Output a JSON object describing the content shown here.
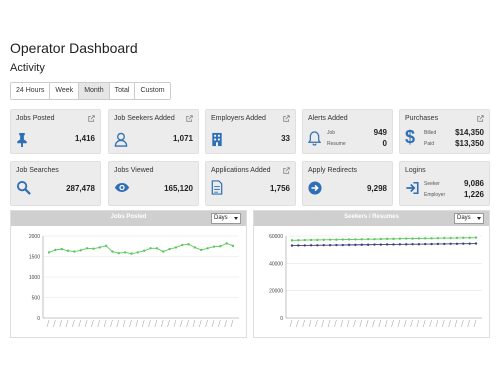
{
  "page": {
    "title": "Operator Dashboard",
    "subtitle": "Activity"
  },
  "tabs": [
    {
      "label": "24 Hours",
      "active": false
    },
    {
      "label": "Week",
      "active": false
    },
    {
      "label": "Month",
      "active": true
    },
    {
      "label": "Total",
      "active": false
    },
    {
      "label": "Custom",
      "active": false
    }
  ],
  "cards": {
    "jobs_posted": {
      "title": "Jobs Posted",
      "value": "1,416",
      "icon": "pushpin-icon"
    },
    "job_seekers_added": {
      "title": "Job Seekers Added",
      "value": "1,071",
      "icon": "user-icon"
    },
    "employers_added": {
      "title": "Employers Added",
      "value": "33",
      "icon": "building-icon"
    },
    "alerts_added": {
      "title": "Alerts Added",
      "icon": "bell-icon",
      "job_label": "Job",
      "job_value": "949",
      "resume_label": "Resume",
      "resume_value": "0"
    },
    "purchases": {
      "title": "Purchases",
      "icon": "dollar-icon",
      "billed_label": "Billed",
      "billed_value": "$14,350",
      "paid_label": "Paid",
      "paid_value": "$13,350"
    },
    "job_searches": {
      "title": "Job Searches",
      "value": "287,478",
      "icon": "search-icon"
    },
    "jobs_viewed": {
      "title": "Jobs Viewed",
      "value": "165,120",
      "icon": "eye-icon"
    },
    "applications_added": {
      "title": "Applications Added",
      "value": "1,756",
      "icon": "document-icon"
    },
    "apply_redirects": {
      "title": "Apply Redirects",
      "value": "9,298",
      "icon": "arrow-circle-icon"
    },
    "logins": {
      "title": "Logins",
      "icon": "sign-in-icon",
      "seeker_label": "Seeker",
      "seeker_value": "9,086",
      "employer_label": "Employer",
      "employer_value": "1,226"
    }
  },
  "panels": {
    "jobs_posted": {
      "title": "Jobs Posted",
      "select": "Days"
    },
    "seekers_resumes": {
      "title": "Seekers / Resumes",
      "select": "Days"
    }
  },
  "colors": {
    "green": "#5cc85c",
    "navy": "#3c3f78",
    "card_bg": "#ececec",
    "header_bg": "#cfcfcf"
  },
  "chart_data": [
    {
      "type": "line",
      "title": "Jobs Posted",
      "ylim": [
        0,
        2000
      ],
      "yticks": [
        0,
        500,
        1000,
        1500,
        2000
      ],
      "series": [
        {
          "values": [
            1600,
            1660,
            1680,
            1640,
            1620,
            1650,
            1700,
            1690,
            1720,
            1760,
            1620,
            1580,
            1600,
            1570,
            1600,
            1640,
            1700,
            1700,
            1620,
            1680,
            1720,
            1780,
            1800,
            1720,
            1660,
            1700,
            1740,
            1750,
            1820,
            1760
          ]
        }
      ]
    },
    {
      "type": "line",
      "title": "Seekers / Resumes",
      "ylim": [
        0,
        60000
      ],
      "yticks": [
        0,
        20000,
        40000,
        60000
      ],
      "series": [
        {
          "values": [
            56800,
            56900,
            57000,
            57100,
            57100,
            57200,
            57300,
            57300,
            57400,
            57500,
            57500,
            57600,
            57700,
            57700,
            57800,
            57900,
            57900,
            58000,
            58100,
            58100,
            58200,
            58300,
            58300,
            58400,
            58500,
            58500,
            58600,
            58700,
            58700,
            58800
          ]
        },
        {
          "values": [
            53000,
            53100,
            53100,
            53200,
            53200,
            53300,
            53300,
            53400,
            53400,
            53500,
            53500,
            53600,
            53600,
            53700,
            53700,
            53800,
            53800,
            53900,
            53900,
            54000,
            54000,
            54100,
            54100,
            54200,
            54200,
            54300,
            54300,
            54400,
            54400,
            54500
          ]
        }
      ]
    }
  ]
}
